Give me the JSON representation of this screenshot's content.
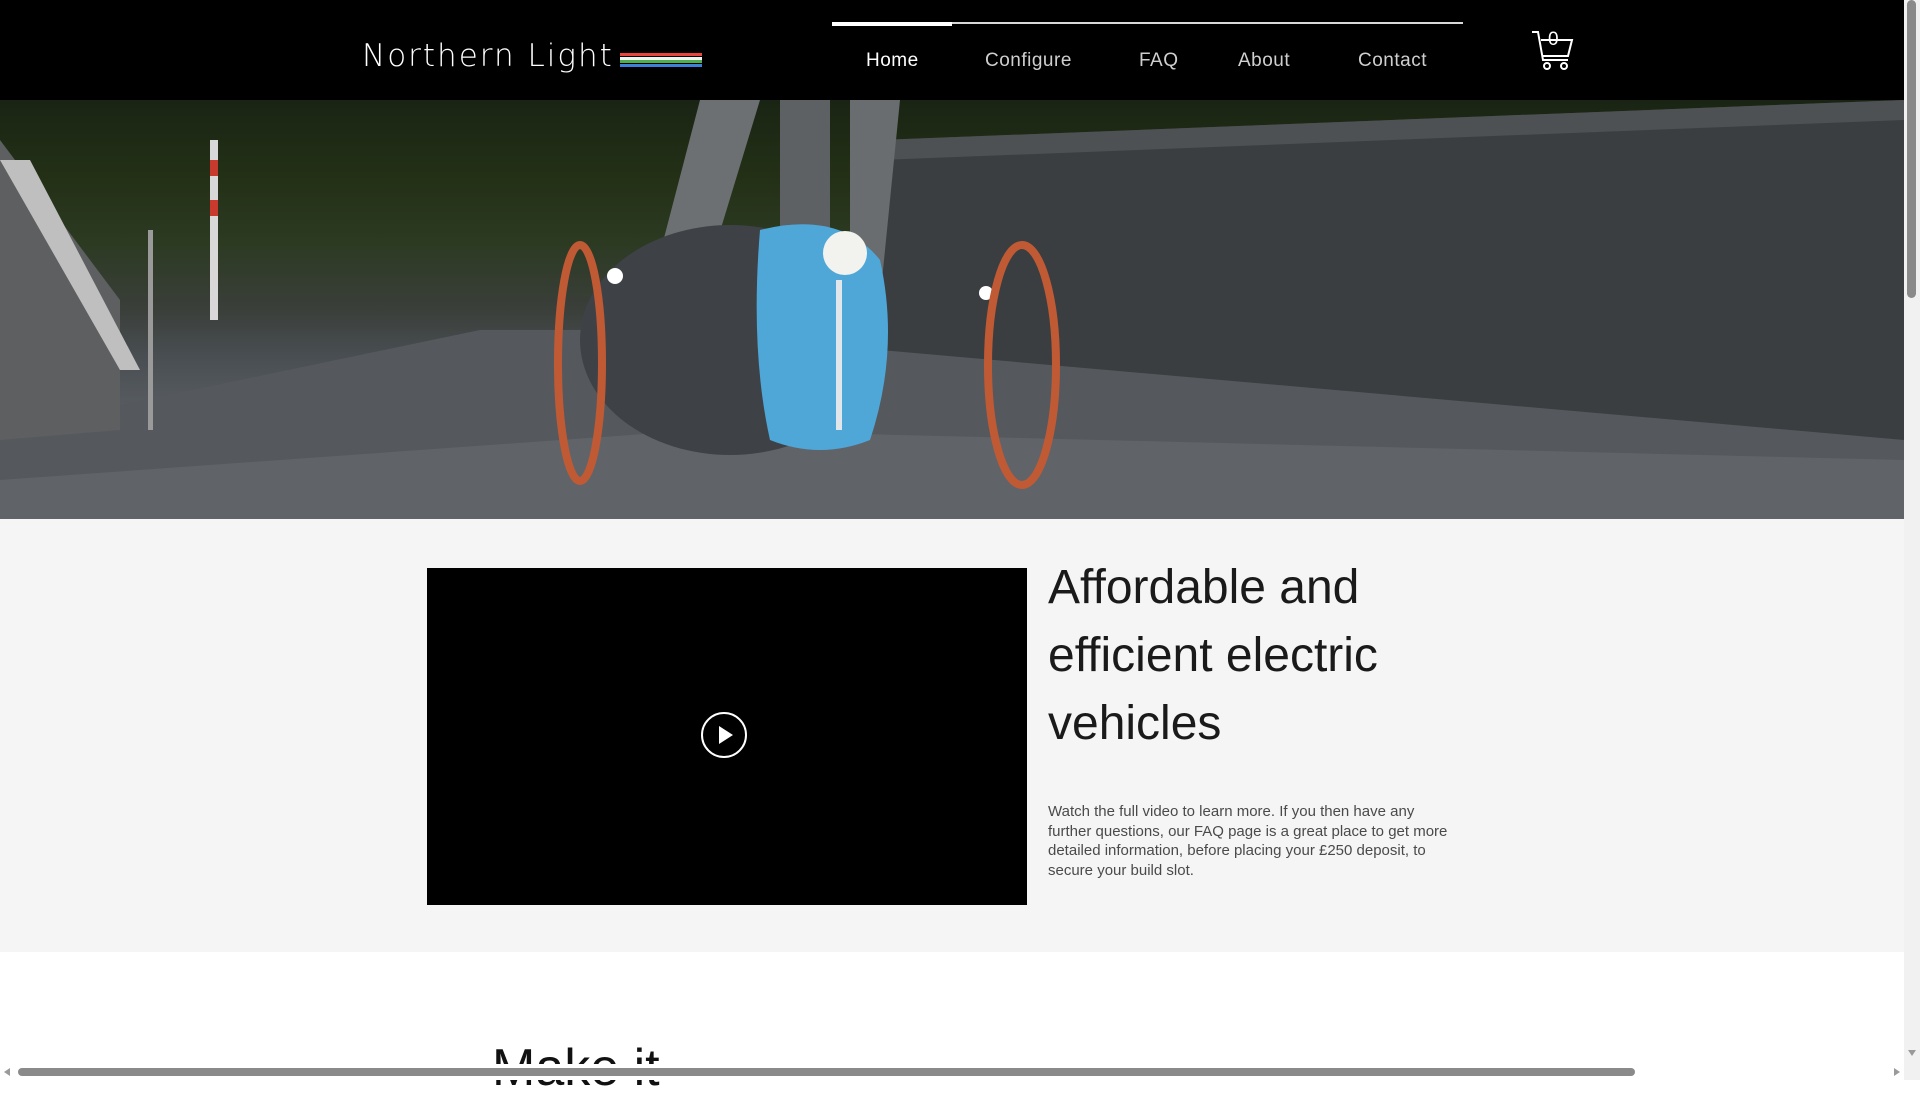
{
  "brand": {
    "name": "Northern Light",
    "stripe_colors": [
      "#e8453c",
      "#f4f4f4",
      "#4caf50",
      "#3d7fd9"
    ]
  },
  "nav": {
    "items": [
      {
        "label": "Home",
        "active": true
      },
      {
        "label": "Configure",
        "active": false
      },
      {
        "label": "FAQ",
        "active": false
      },
      {
        "label": "About",
        "active": false
      },
      {
        "label": "Contact",
        "active": false
      }
    ]
  },
  "cart": {
    "count": "0",
    "icon": "cart-icon"
  },
  "hero": {
    "image": "three-wheeled-electric-vehicle-on-bridge"
  },
  "video": {
    "play_icon": "play-icon"
  },
  "intro": {
    "headline": "Affordable and efficient electric vehicles",
    "body": "Watch the full video to learn more.  If you then have any further questions, our FAQ page is a great place to get more detailed information, before placing your £250 deposit, to secure your build slot."
  },
  "next_section": {
    "heading": "Make it"
  },
  "colors": {
    "header_bg": "#000000",
    "section_bg": "#f5f5f5",
    "accent_white": "#ffffff"
  }
}
